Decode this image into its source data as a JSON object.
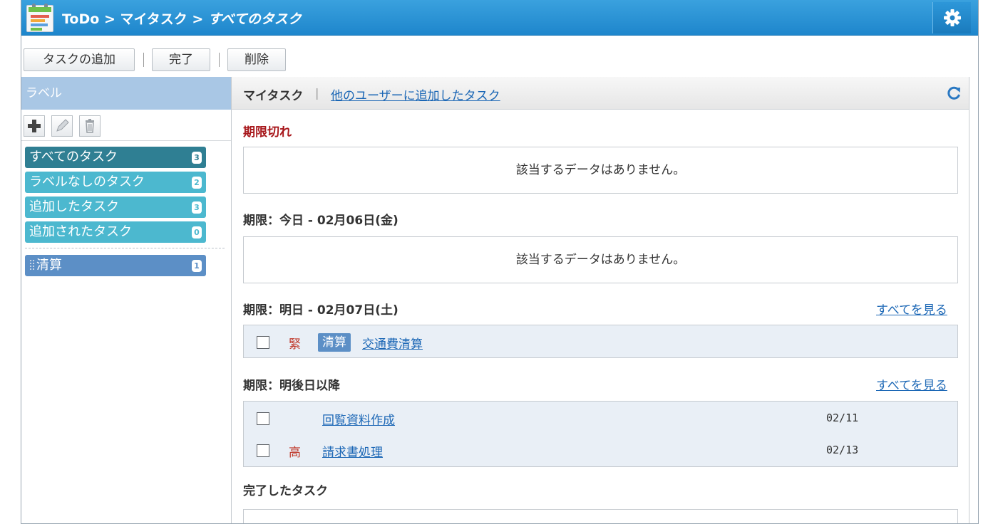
{
  "titlebar": {
    "breadcrumb_app": "ToDo",
    "breadcrumb_sep1": " > ",
    "breadcrumb_section": "マイタスク",
    "breadcrumb_sep2": " > ",
    "breadcrumb_current": "すべてのタスク",
    "settings_icon": "gear-icon"
  },
  "toolbar": {
    "add_task_label": "タスクの追加",
    "complete_label": "完了",
    "delete_label": "削除"
  },
  "sidebar": {
    "header": "ラベル",
    "tools": [
      "plus-icon",
      "pencil-icon",
      "trash-icon"
    ],
    "items": [
      {
        "label": "すべてのタスク",
        "count": "3",
        "color": "#2f7f93"
      },
      {
        "label": "ラベルなしのタスク",
        "count": "2",
        "color": "#4cb8cf"
      },
      {
        "label": "追加したタスク",
        "count": "3",
        "color": "#4cb8cf"
      },
      {
        "label": "追加されたタスク",
        "count": "0",
        "color": "#4cb8cf"
      }
    ],
    "custom_labels": [
      {
        "label": "清算",
        "count": "1",
        "color": "#5c8fc6"
      }
    ]
  },
  "main": {
    "tab_my_tasks": "マイタスク",
    "tab_separator": "|",
    "tab_other_users": "他のユーザーに追加したタスク",
    "refresh_icon": "refresh-icon",
    "sections": {
      "overdue": {
        "title": "期限切れ",
        "empty": "該当するデータはありません。"
      },
      "today": {
        "title": "期限：今日 - 02月06日(金)",
        "empty": "該当するデータはありません。"
      },
      "tomorrow": {
        "title": "期限：明日 - 02月07日(土)",
        "view_all": "すべてを見る",
        "tasks": [
          {
            "priority": "緊",
            "label": "清算",
            "name": "交通費清算",
            "due": ""
          }
        ]
      },
      "later": {
        "title": "期限：明後日以降",
        "view_all": "すべてを見る",
        "tasks": [
          {
            "priority": "",
            "name": "回覧資料作成",
            "due": "02/11"
          },
          {
            "priority": "高",
            "name": "請求書処理",
            "due": "02/13"
          }
        ]
      },
      "completed": {
        "title": "完了したタスク"
      }
    }
  },
  "colors": {
    "titlebar": "#2a94d6",
    "sidebar_header": "#a9c7e5",
    "link": "#1a66b5",
    "overdue_title": "#a8181c",
    "priority": "#c0392b",
    "task_row_bg": "#e9eff6"
  }
}
